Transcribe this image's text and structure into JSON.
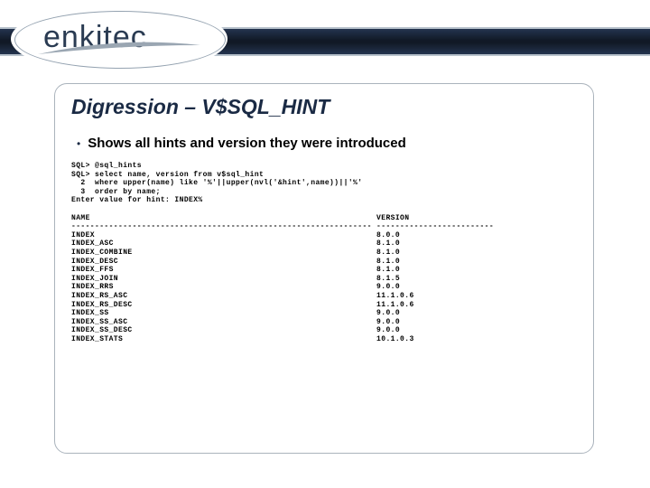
{
  "logo": {
    "text": "enkitec"
  },
  "title": "Digression – V$SQL_HINT",
  "bullet": "Shows all hints and version they were introduced",
  "sql_block": "SQL> @sql_hints\nSQL> select name, version from v$sql_hint\n  2  where upper(name) like '%'||upper(nvl('&hint',name))||'%'\n  3  order by name;\nEnter value for hint: INDEX%",
  "table": {
    "name_header": "NAME",
    "version_header": "VERSION",
    "name_rule": "----------------------------------------------------------------",
    "version_rule": "-------------------------",
    "rows": [
      {
        "name": "INDEX",
        "version": "8.0.0"
      },
      {
        "name": "INDEX_ASC",
        "version": "8.1.0"
      },
      {
        "name": "INDEX_COMBINE",
        "version": "8.1.0"
      },
      {
        "name": "INDEX_DESC",
        "version": "8.1.0"
      },
      {
        "name": "INDEX_FFS",
        "version": "8.1.0"
      },
      {
        "name": "INDEX_JOIN",
        "version": "8.1.5"
      },
      {
        "name": "INDEX_RRS",
        "version": "9.0.0"
      },
      {
        "name": "INDEX_RS_ASC",
        "version": "11.1.0.6"
      },
      {
        "name": "INDEX_RS_DESC",
        "version": "11.1.0.6"
      },
      {
        "name": "INDEX_SS",
        "version": "9.0.0"
      },
      {
        "name": "INDEX_SS_ASC",
        "version": "9.0.0"
      },
      {
        "name": "INDEX_SS_DESC",
        "version": "9.0.0"
      },
      {
        "name": "INDEX_STATS",
        "version": "10.1.0.3"
      }
    ]
  }
}
